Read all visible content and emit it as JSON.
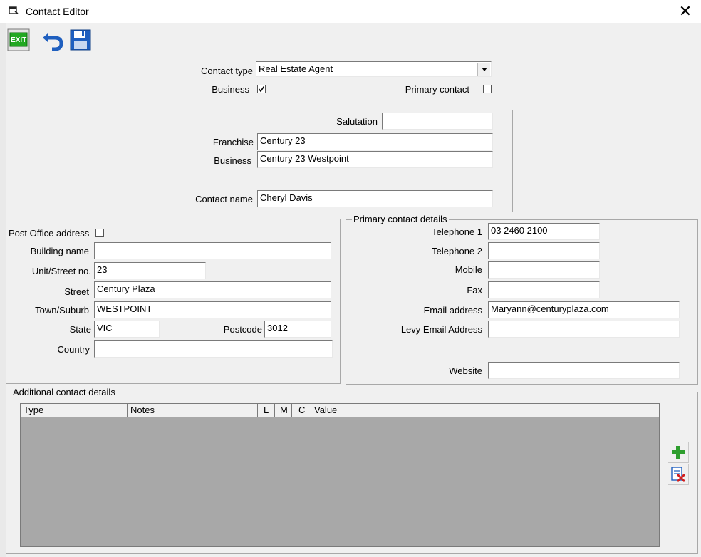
{
  "window": {
    "title": "Contact Editor"
  },
  "toolbar": {
    "exit_label": "EXIT",
    "icons": [
      "exit-icon",
      "undo-icon",
      "save-icon"
    ]
  },
  "contact": {
    "type_label": "Contact type",
    "type_value": "Real Estate Agent",
    "business_label": "Business",
    "business_checked": true,
    "primary_contact_label": "Primary contact",
    "primary_contact_checked": false,
    "salutation_label": "Salutation",
    "salutation_value": "",
    "franchise_label": "Franchise",
    "franchise_value": "Century 23",
    "business_name_label": "Business",
    "business_name_value": "Century 23 Westpoint",
    "contact_name_label": "Contact name",
    "contact_name_value": "Cheryl Davis"
  },
  "address": {
    "po_label": "Post Office address",
    "po_checked": false,
    "building_label": "Building name",
    "building_value": "",
    "unit_label": "Unit/Street no.",
    "unit_value": "23",
    "street_label": "Street",
    "street_value": "Century Plaza",
    "town_label": "Town/Suburb",
    "town_value": "WESTPOINT",
    "state_label": "State",
    "state_value": "VIC",
    "postcode_label": "Postcode",
    "postcode_value": "3012",
    "country_label": "Country",
    "country_value": ""
  },
  "primary_details": {
    "legend": "Primary contact details",
    "tel1_label": "Telephone 1",
    "tel1_value": "03 2460 2100",
    "tel2_label": "Telephone 2",
    "tel2_value": "",
    "mobile_label": "Mobile",
    "mobile_value": "",
    "fax_label": "Fax",
    "fax_value": "",
    "email_label": "Email address",
    "email_value": "Maryann@centuryplaza.com",
    "levy_label": "Levy Email Address",
    "levy_value": "",
    "website_label": "Website",
    "website_value": ""
  },
  "additional": {
    "legend": "Additional contact details",
    "columns": [
      "Type",
      "Notes",
      "L",
      "M",
      "C",
      "Value"
    ],
    "rows": [],
    "add_icon": "add-icon",
    "delete_icon": "delete-icon"
  },
  "colors": {
    "exit_green": "#22a822",
    "icon_blue": "#1f5fbf",
    "grid_bg": "#a8a8a8",
    "add_green": "#2e9e2e",
    "delete_red": "#d02020"
  }
}
